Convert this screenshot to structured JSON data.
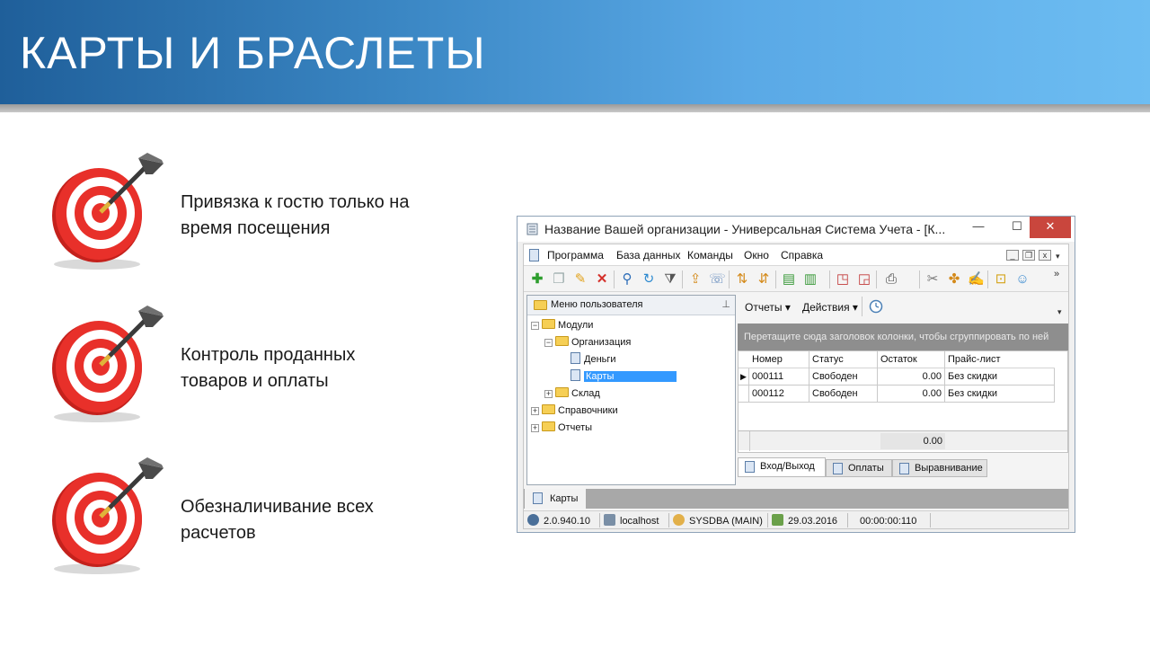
{
  "slide": {
    "title": "КАРТЫ И БРАСЛЕТЫ",
    "bullets": [
      {
        "line1": "Привязка к гостю только на",
        "line2": "время посещения"
      },
      {
        "line1": "Контроль проданных",
        "line2": "товаров и оплаты"
      },
      {
        "line1": "Обезналичивание всех",
        "line2": "расчетов"
      }
    ]
  },
  "window": {
    "title": "Название Вашей организации - Универсальная Система Учета - [К...",
    "controls": {
      "minimize": "—",
      "maximize": "☐",
      "close": "✕"
    },
    "menu": [
      "Программа",
      "База данных",
      "Команды",
      "Окно",
      "Справка"
    ],
    "mdi": {
      "minimize": "_",
      "restore": "❐",
      "close": "x"
    },
    "toolbar_icons": [
      "add-icon",
      "copy-icon",
      "edit-icon",
      "delete-icon",
      "search-icon",
      "refresh-icon",
      "filter-icon",
      "import-icon",
      "comment-icon",
      "sort-asc-icon",
      "sort-desc-icon",
      "export-icon",
      "export-menu-icon",
      "new-window-icon",
      "close-window-icon",
      "print-icon",
      "tools-icon",
      "palette-icon",
      "note-icon",
      "lock-icon",
      "users-icon"
    ],
    "left_panel": {
      "title": "Меню пользователя",
      "tree": [
        {
          "label": "Модули",
          "level": 0,
          "expander": "−",
          "type": "folder"
        },
        {
          "label": "Организация",
          "level": 1,
          "expander": "−",
          "type": "folder"
        },
        {
          "label": "Деньги",
          "level": 2,
          "type": "doc"
        },
        {
          "label": "Карты",
          "level": 2,
          "type": "doc",
          "selected": true
        },
        {
          "label": "Склад",
          "level": 1,
          "expander": "+",
          "type": "folder"
        },
        {
          "label": "Справочники",
          "level": 0,
          "expander": "+",
          "type": "folder"
        },
        {
          "label": "Отчеты",
          "level": 0,
          "expander": "+",
          "type": "folder"
        }
      ]
    },
    "right_panel": {
      "reports_label": "Отчеты ▾",
      "actions_label": "Действия ▾",
      "group_hint": "Перетащите сюда заголовок колонки, чтобы сгруппировать по ней",
      "columns": [
        "Номер",
        "Статус",
        "Остаток",
        "Прайс-лист"
      ],
      "rows": [
        {
          "number": "000111",
          "status": "Свободен",
          "balance": "0.00",
          "pricelist": "Без скидки"
        },
        {
          "number": "000112",
          "status": "Свободен",
          "balance": "0.00",
          "pricelist": "Без скидки"
        }
      ],
      "total": "0.00",
      "tabs": [
        "Вход/Выход",
        "Оплаты",
        "Выравнивание"
      ]
    },
    "document_tab": "Карты",
    "status": {
      "version": "2.0.940.10",
      "host": "localhost",
      "user": "SYSDBA (MAIN)",
      "date": "29.03.2016",
      "time": "00:00:00:110"
    }
  }
}
